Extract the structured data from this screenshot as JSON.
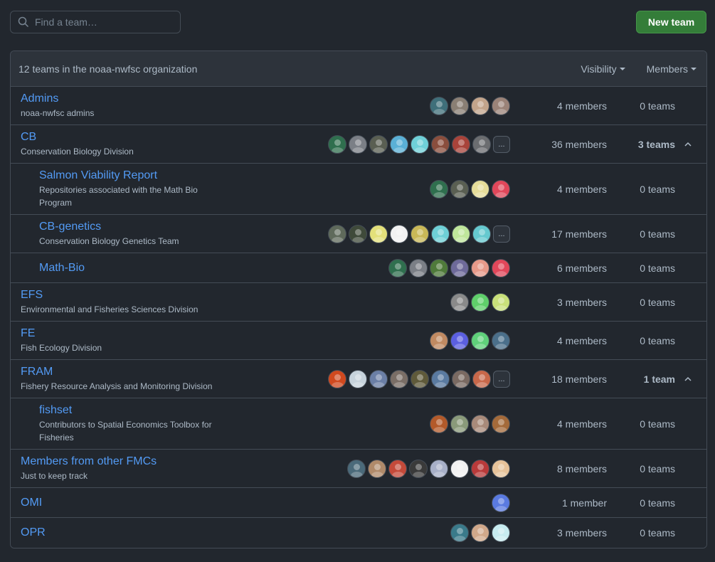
{
  "search": {
    "placeholder": "Find a team…"
  },
  "new_team_label": "New team",
  "header": {
    "count": "12 teams in the noaa-nwfsc organization",
    "visibility": "Visibility",
    "members": "Members"
  },
  "colors": {
    "accent_link": "#539bf5",
    "button_green": "#347d39",
    "bg": "#22272e",
    "header_bg": "#2d333b",
    "border": "#444c56"
  },
  "teams": [
    {
      "name": "Admins",
      "desc": "noaa-nwfsc admins",
      "members": "4 members",
      "teams": "0 teams",
      "avatars": [
        "#3f6f7a",
        "#8a7f74",
        "#c2a48b",
        "#9b8378"
      ],
      "more": false
    },
    {
      "name": "CB",
      "desc": "Conservation Biology Division",
      "members": "36 members",
      "teams": "3 teams",
      "avatars": [
        "#2f6f4e",
        "#7b7f86",
        "#5a5f52",
        "#5ab0d6",
        "#6fd0d8",
        "#8a4e3d",
        "#a8433a",
        "#6b6d70"
      ],
      "more": true,
      "more_label": "...",
      "expanded": true
    },
    {
      "name": "Salmon Viability Report",
      "desc": "Repositories associated with the Math Bio Program",
      "members": "4 members",
      "teams": "0 teams",
      "avatars": [
        "#2f6f4e",
        "#5a5f52",
        "#e6dd9a",
        "#e0475a"
      ],
      "more": false,
      "child": true
    },
    {
      "name": "CB-genetics",
      "desc": "Conservation Biology Genetics Team",
      "members": "17 members",
      "teams": "0 teams",
      "avatars": [
        "#5f6a5b",
        "#3f4a3a",
        "#e3e07a",
        "#f2f2f2",
        "#c9b857",
        "#6ed0d6",
        "#bfe69b",
        "#65c9cf"
      ],
      "more": true,
      "more_label": "...",
      "child": true
    },
    {
      "name": "Math-Bio",
      "desc": "",
      "members": "6 members",
      "teams": "0 teams",
      "avatars": [
        "#2f6f4e",
        "#7b7f86",
        "#4f7a3a",
        "#6e6a9a",
        "#e79a8a",
        "#e0475a"
      ],
      "more": false,
      "child": true
    },
    {
      "name": "EFS",
      "desc": "Environmental and Fisheries Sciences Division",
      "members": "3 members",
      "teams": "0 teams",
      "avatars": [
        "#8a8a8a",
        "#5fcf6a",
        "#c9e07a"
      ],
      "more": false
    },
    {
      "name": "FE",
      "desc": "Fish Ecology Division",
      "members": "4 members",
      "teams": "0 teams",
      "avatars": [
        "#c08a62",
        "#5b5fe0",
        "#5fd07a",
        "#4b6f8a"
      ],
      "more": false
    },
    {
      "name": "FRAM",
      "desc": "Fishery Resource Analysis and Monitoring Division",
      "members": "18 members",
      "teams": "1 team",
      "avatars": [
        "#d0491f",
        "#c7d3dc",
        "#6b7fa6",
        "#7a6e66",
        "#5f5a3a",
        "#5a7aa0",
        "#7a6a62",
        "#c8684a"
      ],
      "more": true,
      "more_label": "...",
      "expanded": true
    },
    {
      "name": "fishset",
      "desc": "Contributors to Spatial Economics Toolbox for Fisheries",
      "members": "4 members",
      "teams": "0 teams",
      "avatars": [
        "#b35a2a",
        "#8a9a7a",
        "#a88a7a",
        "#a46a3a"
      ],
      "more": false,
      "child": true
    },
    {
      "name": "Members from other FMCs",
      "desc": "Just to keep track",
      "members": "8 members",
      "teams": "0 teams",
      "avatars": [
        "#4b6a7a",
        "#b08a6a",
        "#c44a3a",
        "#3a3a3a",
        "#a8b0c8",
        "#f2f2f2",
        "#b83a3a",
        "#e7c39a"
      ],
      "more": false
    },
    {
      "name": "OMI",
      "desc": "",
      "members": "1 member",
      "teams": "0 teams",
      "avatars": [
        "#5a7ae0"
      ],
      "more": false
    },
    {
      "name": "OPR",
      "desc": "",
      "members": "3 members",
      "teams": "0 teams",
      "avatars": [
        "#3a7a8a",
        "#d0a88a",
        "#c7ecf0"
      ],
      "more": false
    }
  ]
}
